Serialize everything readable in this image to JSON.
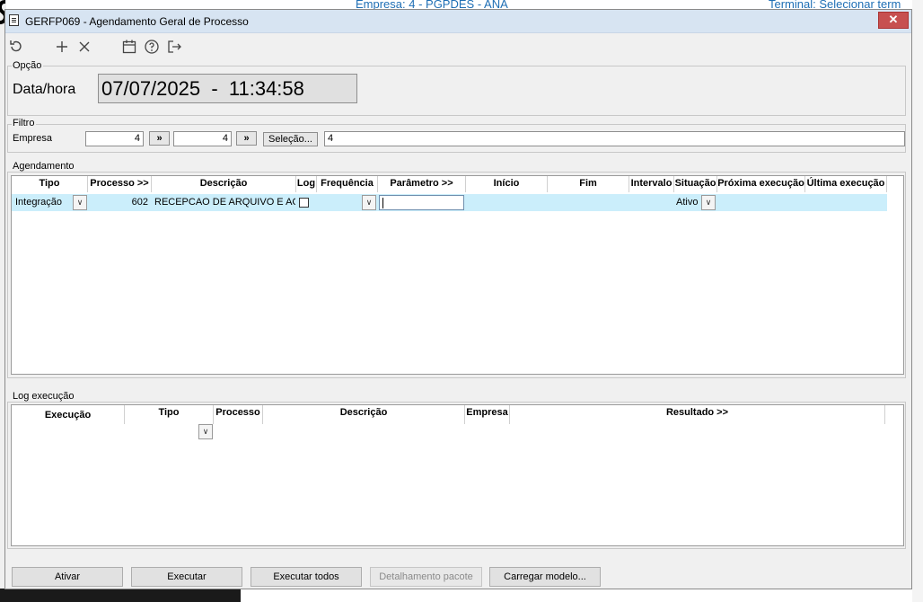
{
  "background": {
    "top_text_left": "Empresa: 4 - PGPDES - ANA",
    "top_text_right": "Terminal: Selecionar term"
  },
  "window": {
    "title": "GERFP069 - Agendamento Geral de Processo",
    "close_label": "✕"
  },
  "toolbar": {
    "icons": [
      "refresh-icon",
      "add-icon",
      "delete-icon",
      "calendar-icon",
      "help-icon",
      "exit-icon"
    ]
  },
  "opcao": {
    "legend": "Opção",
    "label": "Data/hora",
    "datetime": "07/07/2025  -  11:34:58"
  },
  "filtro": {
    "legend": "Filtro",
    "empresa_label": "Empresa",
    "empresa_from": "4",
    "empresa_to": "4",
    "arrow_label": "»",
    "selecao_label": "Seleção...",
    "selecao_value": "4"
  },
  "agendamento": {
    "legend": "Agendamento",
    "columns": [
      "Tipo",
      "Processo >>",
      "Descrição",
      "Log",
      "Frequência",
      "Parâmetro >>",
      "Início",
      "Fim",
      "Intervalo",
      "Situação",
      "Próxima execução",
      "Última execução"
    ],
    "row": {
      "tipo": "Integração",
      "processo": "602",
      "descricao": "RECEPCAO DE ARQUIVO E ACEITE",
      "log": false,
      "frequencia": "",
      "parametro": "",
      "inicio": "",
      "fim": "",
      "intervalo": "",
      "situacao": "Ativo",
      "proxima": "",
      "ultima": ""
    }
  },
  "log_execucao": {
    "legend": "Log execução",
    "columns": [
      "Execução",
      "Tipo",
      "Processo",
      "Descrição",
      "Empresa",
      "Resultado >>"
    ]
  },
  "buttons": {
    "ativar": "Ativar",
    "executar": "Executar",
    "executar_todos": "Executar todos",
    "detalhamento": "Detalhamento pacote",
    "carregar": "Carregar modelo..."
  },
  "colors": {
    "title_bar": "#d7e4f2",
    "row_highlight": "#cbeefb",
    "close_button": "#c75050"
  }
}
